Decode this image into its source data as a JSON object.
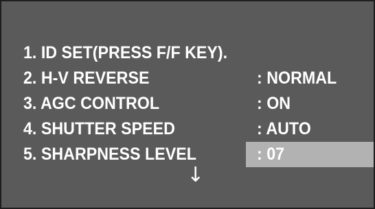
{
  "menu": {
    "items": [
      {
        "label": "1. ID SET(PRESS F/F KEY).",
        "value": ""
      },
      {
        "label": "2. H-V REVERSE",
        "value": ": NORMAL"
      },
      {
        "label": "3. AGC CONTROL",
        "value": ": ON"
      },
      {
        "label": "4. SHUTTER SPEED",
        "value": ": AUTO"
      },
      {
        "label": "5. SHARPNESS LEVEL",
        "value": ": 07"
      }
    ],
    "selected_index": 4,
    "more_indicator": "↓"
  },
  "colors": {
    "background": "#5a5a5a",
    "text": "#ffffff",
    "highlight": "#b2b2b2"
  },
  "icons": {
    "more_indicator": "down-arrow-icon"
  }
}
